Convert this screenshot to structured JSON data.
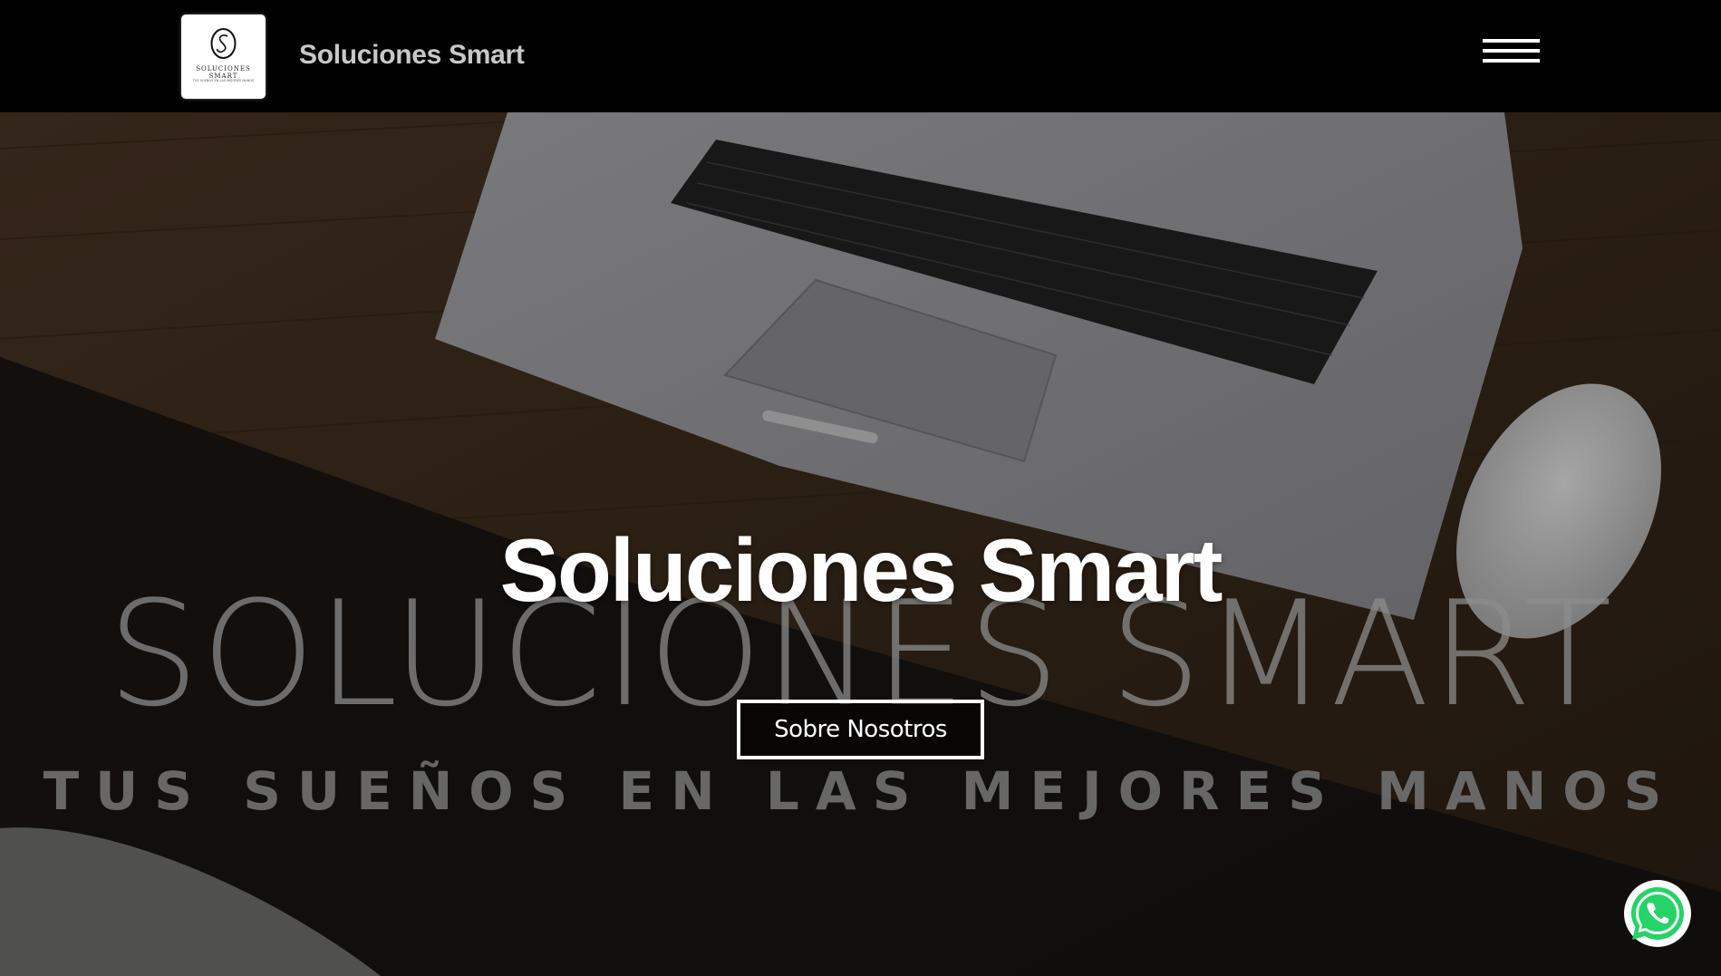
{
  "header": {
    "brand_title": "Soluciones Smart",
    "logo": {
      "word": "SOLUCIONES SMART",
      "tagline": "TUS SUEÑOS EN LAS MEJORES MANOS"
    },
    "menu_icon": "hamburger-menu-icon"
  },
  "hero": {
    "title": "Soluciones Smart",
    "background_watermark": "SOLUCIONES SMART",
    "background_tagline": "TUS SUEÑOS EN LAS MEJORES MANOS",
    "cta_label": "Sobre Nosotros"
  },
  "floating": {
    "whatsapp_icon": "whatsapp-icon",
    "whatsapp_color": "#25D366"
  },
  "colors": {
    "header_bg": "#000000",
    "brand_text": "#c8c8c8",
    "hero_title": "#ffffff",
    "cta_border": "#ffffff"
  }
}
